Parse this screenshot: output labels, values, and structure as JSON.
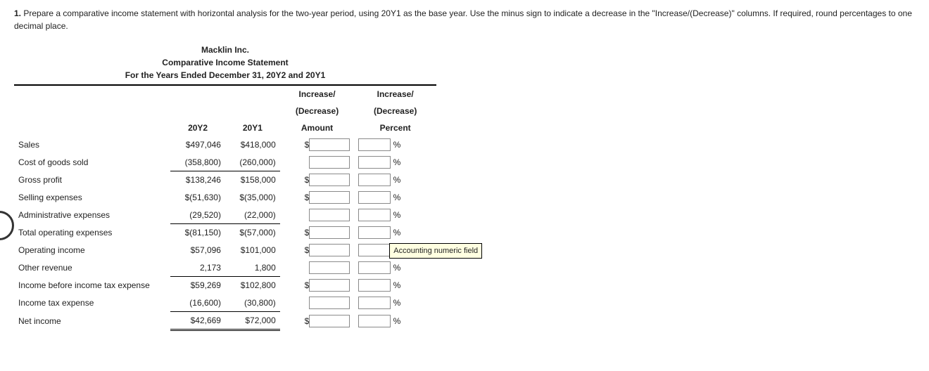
{
  "question": {
    "number": "1.",
    "text": "Prepare a comparative income statement with horizontal analysis for the two-year period, using 20Y1 as the base year. Use the minus sign to indicate a decrease in the \"Increase/(Decrease)\" columns. If required, round percentages to one decimal place."
  },
  "titles": {
    "company": "Macklin Inc.",
    "statement": "Comparative Income Statement",
    "period": "For the Years Ended December 31, 20Y2 and 20Y1"
  },
  "headers": {
    "y2": "20Y2",
    "y1": "20Y1",
    "amt1": "Increase/",
    "amt2": "(Decrease)",
    "amt3": "Amount",
    "pct1": "Increase/",
    "pct2": "(Decrease)",
    "pct3": "Percent"
  },
  "percent_sign": "%",
  "rows": [
    {
      "label": "Sales",
      "y2": "$497,046",
      "y1": "$418,000",
      "dollar": true,
      "y1rule": "",
      "y2rule": ""
    },
    {
      "label": "Cost of goods sold",
      "y2": "(358,800)",
      "y1": "(260,000)",
      "dollar": false,
      "y1rule": "underline-single",
      "y2rule": "underline-single"
    },
    {
      "label": "Gross profit",
      "y2": "$138,246",
      "y1": "$158,000",
      "dollar": true,
      "y1rule": "",
      "y2rule": ""
    },
    {
      "label": "Selling expenses",
      "y2": "$(51,630)",
      "y1": "$(35,000)",
      "dollar": true,
      "y1rule": "",
      "y2rule": ""
    },
    {
      "label": "Administrative expenses",
      "y2": "(29,520)",
      "y1": "(22,000)",
      "dollar": false,
      "y1rule": "underline-single",
      "y2rule": "underline-single"
    },
    {
      "label": "Total operating expenses",
      "y2": "$(81,150)",
      "y1": "$(57,000)",
      "dollar": true,
      "y1rule": "",
      "y2rule": ""
    },
    {
      "label": "Operating income",
      "y2": "$57,096",
      "y1": "$101,000",
      "dollar": true,
      "y1rule": "",
      "y2rule": ""
    },
    {
      "label": "Other revenue",
      "y2": "2,173",
      "y1": "1,800",
      "dollar": false,
      "y1rule": "underline-single",
      "y2rule": "underline-single"
    },
    {
      "label": "Income before income tax expense",
      "y2": "$59,269",
      "y1": "$102,800",
      "dollar": true,
      "y1rule": "",
      "y2rule": ""
    },
    {
      "label": "Income tax expense",
      "y2": "(16,600)",
      "y1": "(30,800)",
      "dollar": false,
      "y1rule": "underline-single",
      "y2rule": "underline-single"
    },
    {
      "label": "Net income",
      "y2": "$42,669",
      "y1": "$72,000",
      "dollar": true,
      "y1rule": "underline-double",
      "y2rule": "underline-double"
    }
  ],
  "tooltip": {
    "row_index": 6,
    "text": "Accounting numeric field"
  }
}
